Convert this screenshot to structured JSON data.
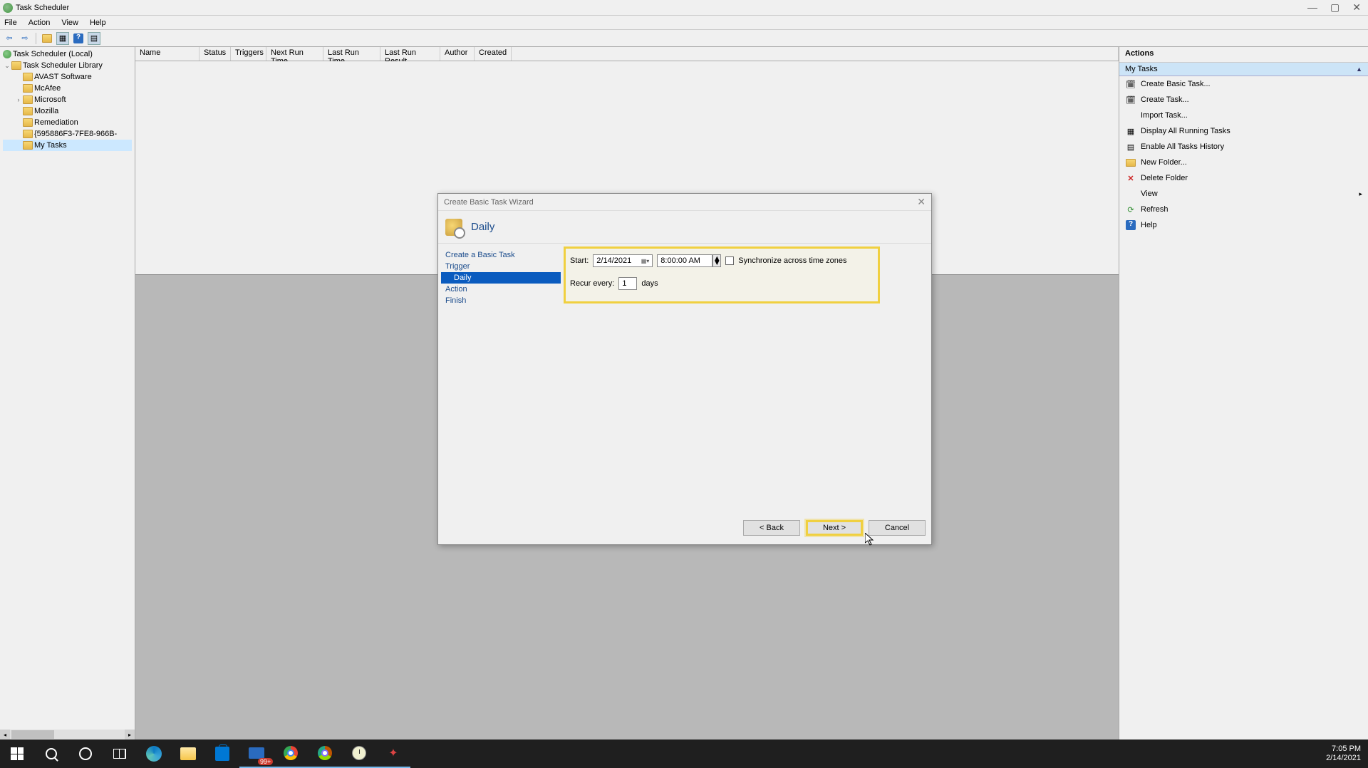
{
  "titlebar": {
    "title": "Task Scheduler"
  },
  "menubar": {
    "file": "File",
    "action": "Action",
    "view": "View",
    "help": "Help"
  },
  "tree": {
    "root": "Task Scheduler (Local)",
    "library": "Task Scheduler Library",
    "items": [
      "AVAST Software",
      "McAfee",
      "Microsoft",
      "Mozilla",
      "Remediation",
      "{595886F3-7FE8-966B-",
      "My Tasks"
    ]
  },
  "list_header": {
    "name": "Name",
    "status": "Status",
    "triggers": "Triggers",
    "next_run": "Next Run Time",
    "last_run": "Last Run Time",
    "last_result": "Last Run Result",
    "author": "Author",
    "created": "Created"
  },
  "actions": {
    "title": "Actions",
    "section": "My Tasks",
    "items": [
      "Create Basic Task...",
      "Create Task...",
      "Import Task...",
      "Display All Running Tasks",
      "Enable All Tasks History",
      "New Folder...",
      "Delete Folder",
      "View",
      "Refresh",
      "Help"
    ]
  },
  "dialog": {
    "title": "Create Basic Task Wizard",
    "banner": "Daily",
    "nav": {
      "create": "Create a Basic Task",
      "trigger": "Trigger",
      "daily": "Daily",
      "action": "Action",
      "finish": "Finish"
    },
    "form": {
      "start_label": "Start:",
      "date": "2/14/2021",
      "time": "8:00:00 AM",
      "sync_label": "Synchronize across time zones",
      "recur_label": "Recur every:",
      "recur_value": "1",
      "days_label": "days"
    },
    "buttons": {
      "back": "< Back",
      "next": "Next >",
      "cancel": "Cancel"
    }
  },
  "taskbar": {
    "badge": "99+",
    "time": "7:05 PM",
    "date": "2/14/2021"
  }
}
